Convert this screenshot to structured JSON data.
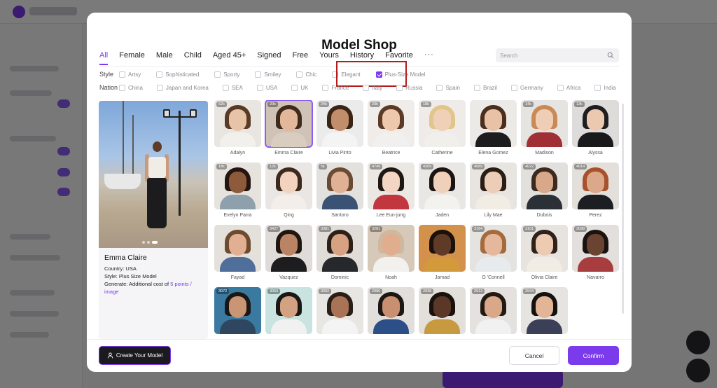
{
  "modal": {
    "title": "Model Shop"
  },
  "tabs": [
    {
      "label": "All",
      "active": true
    },
    {
      "label": "Female"
    },
    {
      "label": "Male"
    },
    {
      "label": "Child"
    },
    {
      "label": "Aged 45+"
    },
    {
      "label": "Signed"
    },
    {
      "label": "Free"
    },
    {
      "label": "Yours"
    },
    {
      "label": "History"
    },
    {
      "label": "Favorite"
    }
  ],
  "tabs_more": "···",
  "search": {
    "placeholder": "Search"
  },
  "filters": {
    "style": {
      "label": "Style",
      "options": [
        {
          "label": "Artsy",
          "checked": false
        },
        {
          "label": "Sophisticated",
          "checked": false
        },
        {
          "label": "Sporty",
          "checked": false
        },
        {
          "label": "Smiley",
          "checked": false
        },
        {
          "label": "Chic",
          "checked": false
        },
        {
          "label": "Elegant",
          "checked": false
        },
        {
          "label": "Plus-Size Model",
          "checked": true
        }
      ]
    },
    "nation": {
      "label": "Nation",
      "options": [
        {
          "label": "China"
        },
        {
          "label": "Japan and Korea"
        },
        {
          "label": "SEA"
        },
        {
          "label": "USA"
        },
        {
          "label": "UK"
        },
        {
          "label": "France"
        },
        {
          "label": "Italy"
        },
        {
          "label": "Russia"
        },
        {
          "label": "Spain"
        },
        {
          "label": "Brazil"
        },
        {
          "label": "Germany"
        },
        {
          "label": "Africa"
        },
        {
          "label": "India"
        }
      ]
    }
  },
  "preview": {
    "name": "Emma Claire",
    "country": "Country: USA",
    "style": "Style: Plus Size Model",
    "generate_prefix": "Generate: Additional cost of ",
    "generate_link": "5 points / image"
  },
  "models": [
    {
      "name": "Adalyn",
      "badge": "52k",
      "skin": "#e7c3a8",
      "hair": "#5a3a26",
      "cloth": "#f2f0ec",
      "bg": "#e9e6e2"
    },
    {
      "name": "Emma Claire",
      "badge": "20k",
      "skin": "#e3b89a",
      "hair": "#3f2a1e",
      "cloth": "#d9cdbf",
      "bg": "#cfc2b6",
      "selected": true
    },
    {
      "name": "Livia Pinto",
      "badge": "24k",
      "skin": "#c28d6a",
      "hair": "#3a2416",
      "cloth": "#f4f4f4",
      "bg": "#ebebeb"
    },
    {
      "name": "Beatrice",
      "badge": "23k",
      "skin": "#edc8ad",
      "hair": "#5b3b25",
      "cloth": "#f2f0ee",
      "bg": "#efece9"
    },
    {
      "name": "Catherine",
      "badge": "18k",
      "skin": "#f1d0b8",
      "hair": "#e2c58a",
      "cloth": "#f1efec",
      "bg": "#eeebe8"
    },
    {
      "name": "Elena Gomez",
      "badge": "",
      "skin": "#e9c2a5",
      "hair": "#4b2e1d",
      "cloth": "#1d1d1f",
      "bg": "#eceae7"
    },
    {
      "name": "Madison",
      "badge": "14k",
      "skin": "#f0cdb5",
      "hair": "#c98a56",
      "cloth": "#a03036",
      "bg": "#e6e4e1"
    },
    {
      "name": "Alyssa",
      "badge": "13k",
      "skin": "#ecc8b0",
      "hair": "#1e1e20",
      "cloth": "#1a1a1c",
      "bg": "#dedcda"
    },
    {
      "name": "Evelyn Parra",
      "badge": "18k",
      "skin": "#8d5a3c",
      "hair": "#241510",
      "cloth": "#8fa0ad",
      "bg": "#e6e3df"
    },
    {
      "name": "Qing",
      "badge": "12k",
      "skin": "#f1d3bf",
      "hair": "#3d2a1c",
      "cloth": "#f3eeea",
      "bg": "#e9e6e3"
    },
    {
      "name": "Santoro",
      "badge": "5k",
      "skin": "#e0b195",
      "hair": "#6b4a33",
      "cloth": "#3a5375",
      "bg": "#e3e1de"
    },
    {
      "name": "Lee Eun-jung",
      "badge": "4749",
      "skin": "#f2d6c3",
      "hair": "#1f1714",
      "cloth": "#c2373e",
      "bg": "#ebe8e4"
    },
    {
      "name": "Jaden",
      "badge": "4309",
      "skin": "#eed0bb",
      "hair": "#1b1412",
      "cloth": "#f4f2ef",
      "bg": "#e9e7e4"
    },
    {
      "name": "Lily Mae",
      "badge": "4089",
      "skin": "#eccdb7",
      "hair": "#2a1d16",
      "cloth": "#f1ece4",
      "bg": "#e8e5e1"
    },
    {
      "name": "Dubois",
      "badge": "4022",
      "skin": "#d9a789",
      "hair": "#3a2a20",
      "cloth": "#2b2f36",
      "bg": "#e2e0dd"
    },
    {
      "name": "Perez",
      "badge": "4014",
      "skin": "#dca88b",
      "hair": "#a8522c",
      "cloth": "#1d1e22",
      "bg": "#e3e0dc"
    },
    {
      "name": "Fayad",
      "badge": "",
      "skin": "#e1b092",
      "hair": "#6e4a2e",
      "cloth": "#4f6f9a",
      "bg": "#e4e1dd"
    },
    {
      "name": "Vazquez",
      "badge": "3427",
      "skin": "#b98464",
      "hair": "#1e1611",
      "cloth": "#1d1d20",
      "bg": "#dedbd8"
    },
    {
      "name": "Dominic",
      "badge": "3381",
      "skin": "#d6a282",
      "hair": "#2d2018",
      "cloth": "#27282c",
      "bg": "#e0ddd9"
    },
    {
      "name": "Noah",
      "badge": "3281",
      "skin": "#e0ae8f",
      "hair": "#d1b79d",
      "cloth": "#f3f1ee",
      "bg": "#d7c9b9"
    },
    {
      "name": "Jamad",
      "badge": "",
      "skin": "#5e3a27",
      "hair": "#1a110c",
      "cloth": "#d29a3a",
      "bg": "#d4914b"
    },
    {
      "name": "O 'Connell",
      "badge": "3164",
      "skin": "#e6b89b",
      "hair": "#a36b3e",
      "cloth": "#e8ebee",
      "bg": "#e5e3e0"
    },
    {
      "name": "Olivia Claire",
      "badge": "3101",
      "skin": "#edcbb3",
      "hair": "#2f221a",
      "cloth": "#f1ece4",
      "bg": "#e7e4e0"
    },
    {
      "name": "Navarro",
      "badge": "3098",
      "skin": "#6a4331",
      "hair": "#1b130f",
      "cloth": "#a83d3f",
      "bg": "#e2dfdc"
    },
    {
      "name": "",
      "badge": "3072",
      "skin": "#c99575",
      "hair": "#1b1714",
      "cloth": "#2e4660",
      "bg": "#3a79a0"
    },
    {
      "name": "",
      "badge": "3050",
      "skin": "#d3a283",
      "hair": "#1b1714",
      "cloth": "#f1f1f1",
      "bg": "#c8e3e0"
    },
    {
      "name": "",
      "badge": "3002",
      "skin": "#a97455",
      "hair": "#2a1f18",
      "cloth": "#f4f4f4",
      "bg": "#e8e6e3"
    },
    {
      "name": "",
      "badge": "2986",
      "skin": "#c89070",
      "hair": "#1d1714",
      "cloth": "#2b4f86",
      "bg": "#e1dfdc"
    },
    {
      "name": "",
      "badge": "2938",
      "skin": "#5a3726",
      "hair": "#1a110c",
      "cloth": "#c89a3f",
      "bg": "#e3e0dc"
    },
    {
      "name": "",
      "badge": "2913",
      "skin": "#d8a888",
      "hair": "#221913",
      "cloth": "#f1f1f1",
      "bg": "#e4e1de"
    },
    {
      "name": "",
      "badge": "2944",
      "skin": "#e2b597",
      "hair": "#15110e",
      "cloth": "#3b3f57",
      "bg": "#e6e4e1"
    }
  ],
  "footer": {
    "create_label": "Create Your Model",
    "cancel_label": "Cancel",
    "confirm_label": "Confirm"
  },
  "colors": {
    "accent": "#7c3aed",
    "highlight": "#b41c1c"
  }
}
